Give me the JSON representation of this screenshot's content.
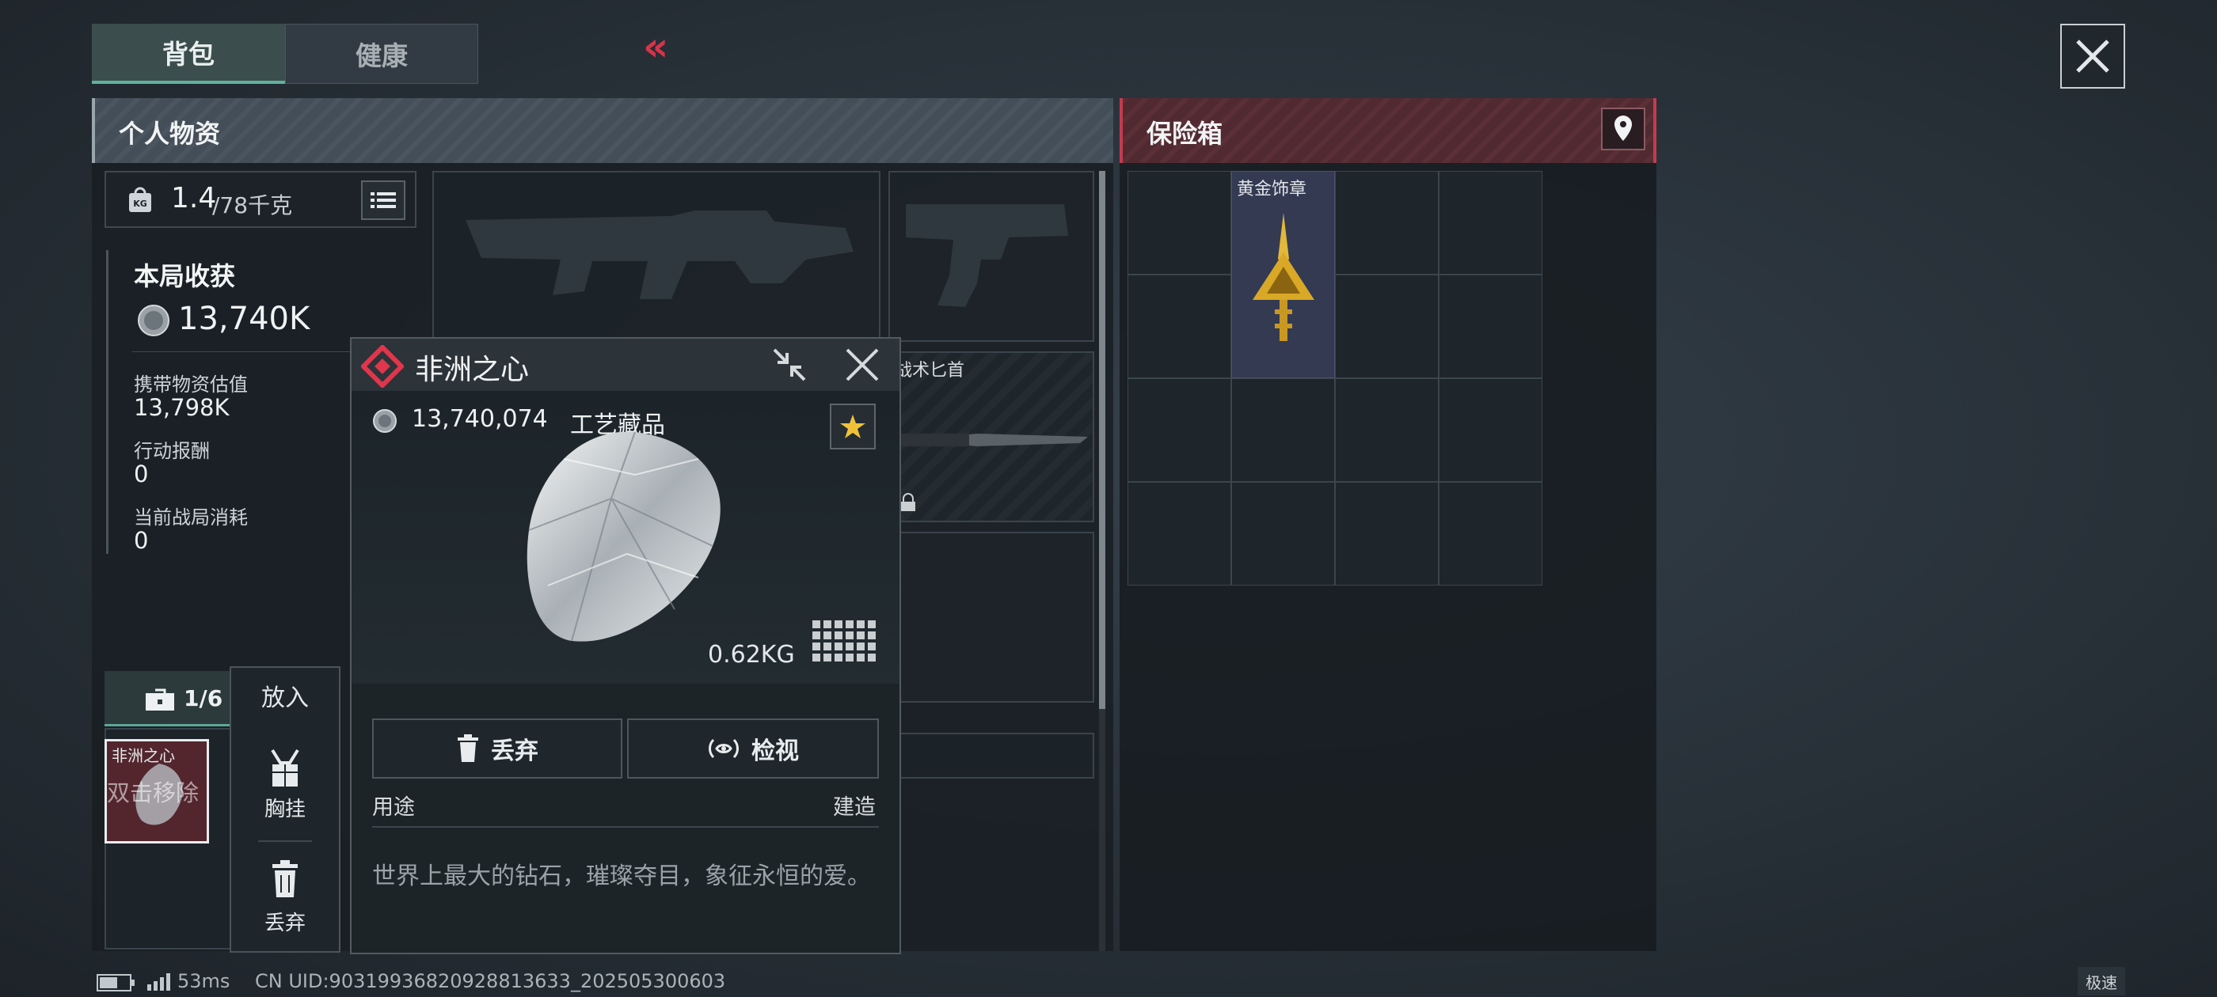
{
  "tabs": [
    {
      "label": "背包",
      "active": true
    },
    {
      "label": "健康",
      "active": false
    }
  ],
  "collapse_glyph": "«",
  "personal": {
    "title": "个人物资",
    "weight_value": "1.4",
    "weight_max": "/78千克",
    "harvest_title": "本局收获",
    "harvest_value": "13,740K",
    "carry_label": "携带物资估值",
    "carry_value": "13,798K",
    "reward_label": "行动报酬",
    "reward_value": "0",
    "cost_label": "当前战局消耗",
    "cost_value": "0",
    "knife_label": "战术匕首",
    "container_count": "1/6",
    "slot_item_name": "非洲之心",
    "slot_item_hint": "双击移除"
  },
  "action_menu": {
    "put_in": "放入",
    "chest_rig": "胸挂",
    "discard": "丢弃"
  },
  "safe": {
    "title": "保险箱",
    "item_label": "黄金饰章"
  },
  "popup": {
    "title": "非洲之心",
    "price": "13,740,074",
    "category": "工艺藏品",
    "weight": "0.62KG",
    "discard_label": "丢弃",
    "inspect_label": "检视",
    "use_label": "用途",
    "use_value": "建造",
    "description": "世界上最大的钻石，璀璨夺目，象征永恒的爱。"
  },
  "footer": {
    "ping": "53ms",
    "uid": "CN UID:90319936820928813633_202505300603",
    "mode": "极速"
  },
  "colors": {
    "accent_teal": "#5fb29d",
    "accent_red": "#c43b4e",
    "gold": "#d9a826",
    "star": "#f0c23a"
  },
  "icons": [
    "kg-weight-icon",
    "list-icon",
    "coin-icon",
    "rarity-diamond-icon",
    "shrink-icon",
    "close-icon",
    "star-icon",
    "grid-size-icon",
    "trash-icon",
    "eye-icon",
    "chest-rig-icon",
    "toolbox-icon",
    "location-pin-icon",
    "battery-icon",
    "signal-icon"
  ]
}
